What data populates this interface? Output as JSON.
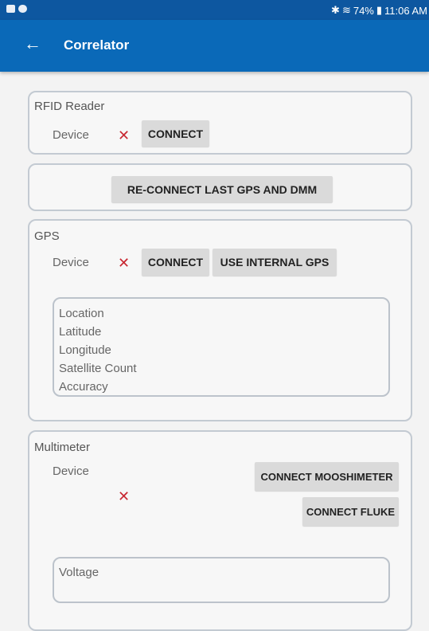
{
  "status_bar": {
    "battery": "74%",
    "time": "11:06 AM",
    "bluetooth_icon": "bluetooth-icon",
    "wifi_icon": "wifi-icon"
  },
  "app_bar": {
    "back_glyph": "←",
    "title": "Correlator"
  },
  "rfid": {
    "title": "RFID Reader",
    "device_label": "Device",
    "status": "✕",
    "connect_label": "CONNECT"
  },
  "reconnect": {
    "label": "RE-CONNECT LAST GPS AND DMM"
  },
  "gps": {
    "title": "GPS",
    "device_label": "Device",
    "status": "✕",
    "connect_label": "CONNECT",
    "internal_label": "USE INTERNAL GPS",
    "fields": [
      "Location",
      "Latitude",
      "Longitude",
      "Satellite Count",
      "Accuracy"
    ]
  },
  "multimeter": {
    "title": "Multimeter",
    "device_label": "Device",
    "status": "✕",
    "mooshimeter_label": "CONNECT MOOSHIMETER",
    "fluke_label": "CONNECT FLUKE",
    "voltage_label": "Voltage"
  },
  "colors": {
    "status_bar": "#0d57a0",
    "app_bar": "#0a69b8",
    "disconnected": "#c82832"
  }
}
